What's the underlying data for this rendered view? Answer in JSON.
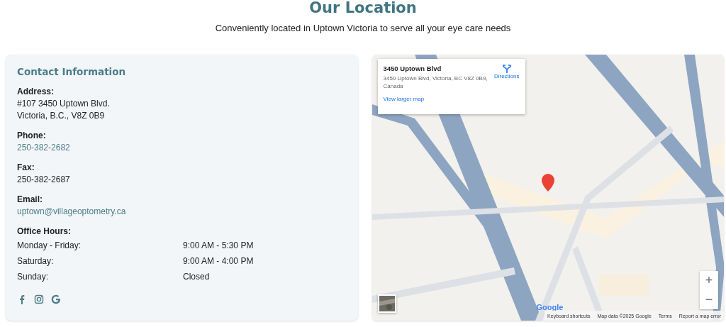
{
  "header": {
    "title": "Our Location",
    "subtitle": "Conveniently located in Uptown Victoria to serve all your eye care needs"
  },
  "contact": {
    "title": "Contact Information",
    "sections": [
      {
        "label": "Address:",
        "kind": "text",
        "lines": [
          "#107 3450 Uptown Blvd.",
          "Victoria, B.C., V8Z 0B9"
        ]
      },
      {
        "label": "Phone:",
        "kind": "link",
        "lines": [
          "250-382-2682"
        ]
      },
      {
        "label": "Fax:",
        "kind": "text",
        "lines": [
          "250-382-2687"
        ]
      },
      {
        "label": "Email:",
        "kind": "link",
        "lines": [
          "uptown@villageoptometry.ca"
        ]
      }
    ],
    "hours_label": "Office Hours:",
    "hours": [
      {
        "day": "Monday - Friday:",
        "time": "9:00 AM - 5:30 PM"
      },
      {
        "day": "Saturday:",
        "time": "9:00 AM - 4:00 PM"
      },
      {
        "day": "Sunday:",
        "time": "Closed"
      }
    ],
    "social": [
      {
        "kind": "facebook"
      },
      {
        "kind": "instagram"
      },
      {
        "kind": "google"
      }
    ]
  },
  "map": {
    "kind": "picture",
    "place_card": {
      "title": "3450 Uptown Blvd",
      "address": "3450 Uptown Blvd, Victoria, BC V8Z 0B9, Canada",
      "directions": "Directions",
      "larger_map": "View larger map"
    },
    "zoom_in": "+",
    "zoom_out": "−",
    "logo": "Google",
    "footer": [
      "Keyboard shortcuts",
      "Map data ©2025 Google",
      "Terms",
      "Report a map error"
    ]
  }
}
